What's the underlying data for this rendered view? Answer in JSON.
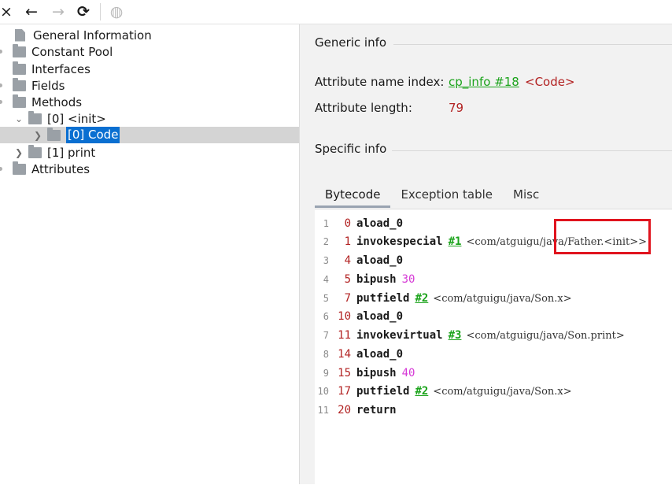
{
  "toolbar": {
    "close_icon": "×",
    "back_icon": "←",
    "forward_icon": "→",
    "refresh_icon": "⟳",
    "web_icon": "◍"
  },
  "tree": {
    "items": [
      {
        "label": "General Information"
      },
      {
        "label": "Constant Pool"
      },
      {
        "label": "Interfaces"
      },
      {
        "label": "Fields"
      },
      {
        "label": "Methods"
      },
      {
        "label": "[0] <init>"
      },
      {
        "label": "[0] Code"
      },
      {
        "label": "[1] print"
      },
      {
        "label": "Attributes"
      }
    ]
  },
  "generic": {
    "title": "Generic info",
    "attr_name_label": "Attribute name index:",
    "attr_name_link": "cp_info #18",
    "attr_name_value": "<Code>",
    "attr_length_label": "Attribute length:",
    "attr_length_value": "79"
  },
  "specific": {
    "title": "Specific info"
  },
  "tabs": [
    {
      "label": "Bytecode"
    },
    {
      "label": "Exception table"
    },
    {
      "label": "Misc"
    }
  ],
  "bytecode": [
    {
      "line": "1",
      "offset": "0",
      "op": "aload_0",
      "ref": "",
      "num": "",
      "comment": ""
    },
    {
      "line": "2",
      "offset": "1",
      "op": "invokespecial",
      "ref": "#1",
      "num": "",
      "comment": "<com/atguigu/java/Father.<init>>"
    },
    {
      "line": "3",
      "offset": "4",
      "op": "aload_0",
      "ref": "",
      "num": "",
      "comment": ""
    },
    {
      "line": "4",
      "offset": "5",
      "op": "bipush",
      "ref": "",
      "num": "30",
      "comment": ""
    },
    {
      "line": "5",
      "offset": "7",
      "op": "putfield",
      "ref": "#2",
      "num": "",
      "comment": "<com/atguigu/java/Son.x>"
    },
    {
      "line": "6",
      "offset": "10",
      "op": "aload_0",
      "ref": "",
      "num": "",
      "comment": ""
    },
    {
      "line": "7",
      "offset": "11",
      "op": "invokevirtual",
      "ref": "#3",
      "num": "",
      "comment": "<com/atguigu/java/Son.print>"
    },
    {
      "line": "8",
      "offset": "14",
      "op": "aload_0",
      "ref": "",
      "num": "",
      "comment": ""
    },
    {
      "line": "9",
      "offset": "15",
      "op": "bipush",
      "ref": "",
      "num": "40",
      "comment": ""
    },
    {
      "line": "10",
      "offset": "17",
      "op": "putfield",
      "ref": "#2",
      "num": "",
      "comment": "<com/atguigu/java/Son.x>"
    },
    {
      "line": "11",
      "offset": "20",
      "op": "return",
      "ref": "",
      "num": "",
      "comment": ""
    }
  ]
}
